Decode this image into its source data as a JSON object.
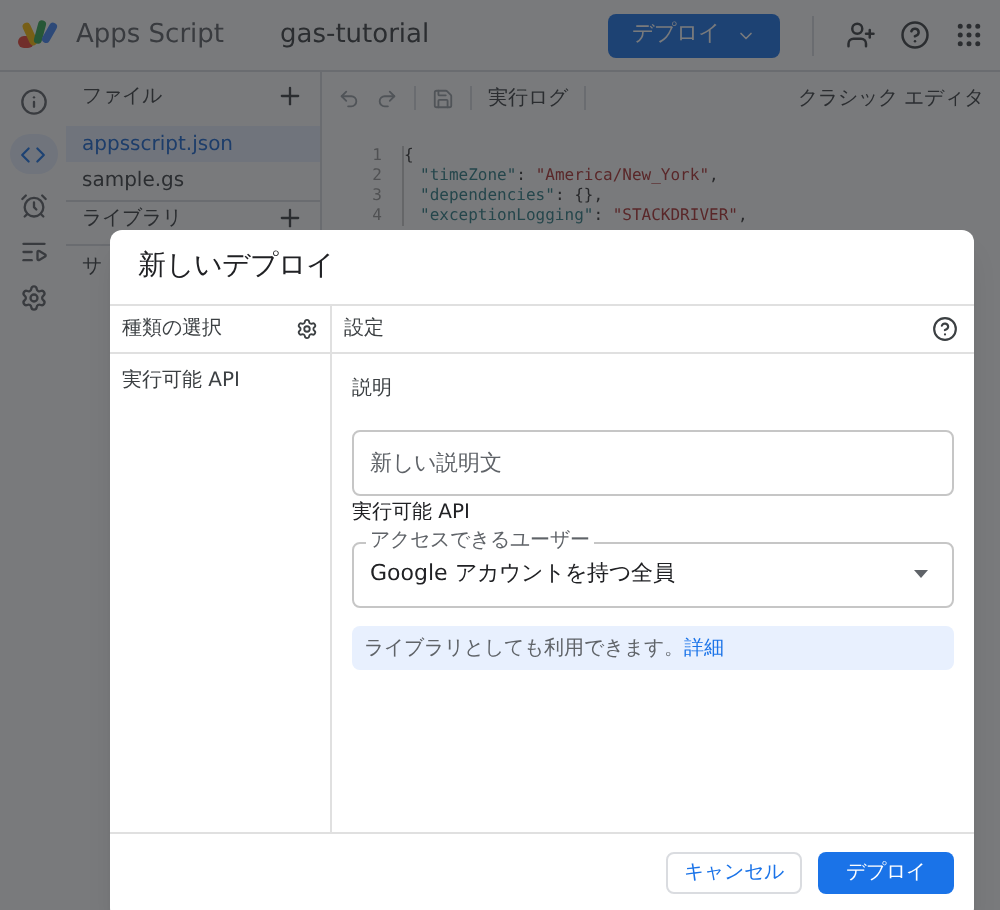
{
  "app": {
    "logo_text": "Apps Script",
    "project": "gas-tutorial",
    "deploy_button": "デプロイ"
  },
  "files_panel": {
    "title": "ファイル",
    "files": [
      {
        "name": "appsscript.json",
        "selected": true
      },
      {
        "name": "sample.gs",
        "selected": false
      }
    ],
    "libraries_title": "ライブラリ",
    "services_title": "サ"
  },
  "toolbar": {
    "run_log": "実行ログ",
    "classic_editor": "クラシック エディタ"
  },
  "code": [
    {
      "number": "1",
      "tokens": [
        {
          "kind": "punct",
          "text": "{"
        }
      ]
    },
    {
      "number": "2",
      "tokens": [
        {
          "kind": "key",
          "text": "\"timeZone\""
        },
        {
          "kind": "punct",
          "text": ": "
        },
        {
          "kind": "string",
          "text": "\"America/New_York\""
        },
        {
          "kind": "punct",
          "text": ","
        }
      ]
    },
    {
      "number": "3",
      "tokens": [
        {
          "kind": "key",
          "text": "\"dependencies\""
        },
        {
          "kind": "punct",
          "text": ": {},"
        }
      ]
    },
    {
      "number": "4",
      "tokens": [
        {
          "kind": "key",
          "text": "\"exceptionLogging\""
        },
        {
          "kind": "punct",
          "text": ": "
        },
        {
          "kind": "string",
          "text": "\"STACKDRIVER\""
        },
        {
          "kind": "punct",
          "text": ","
        }
      ]
    }
  ],
  "dialog": {
    "title": "新しいデプロイ",
    "left_header": "種類の選択",
    "types": [
      {
        "label": "実行可能 API",
        "selected": false
      }
    ],
    "right_header": "設定",
    "description_label": "説明",
    "description_placeholder": "新しい説明文",
    "section_title": "実行可能 API",
    "access_label": "アクセスできるユーザー",
    "access_value": "Google アカウントを持つ全員",
    "info_text": "ライブラリとしても利用できます。",
    "info_link": "詳細",
    "buttons": [
      {
        "kind": "outlined",
        "label": "キャンセル"
      },
      {
        "kind": "primary",
        "label": "デプロイ"
      }
    ]
  }
}
